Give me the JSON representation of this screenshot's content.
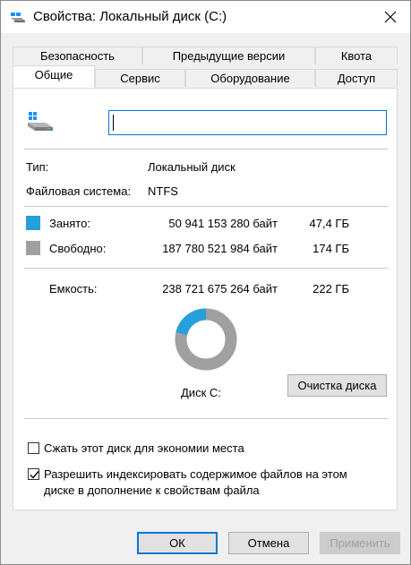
{
  "window": {
    "title": "Свойства: Локальный диск (C:)"
  },
  "tabs": {
    "row1": [
      "Безопасность",
      "Предыдущие версии",
      "Квота"
    ],
    "row2": [
      "Общие",
      "Сервис",
      "Оборудование",
      "Доступ"
    ]
  },
  "general": {
    "name_value": "",
    "type_label": "Тип:",
    "type_value": "Локальный диск",
    "fs_label": "Файловая система:",
    "fs_value": "NTFS",
    "used_label": "Занято:",
    "used_bytes": "50 941 153 280 байт",
    "used_gb": "47,4 ГБ",
    "free_label": "Свободно:",
    "free_bytes": "187 780 521 984 байт",
    "free_gb": "174 ГБ",
    "capacity_label": "Емкость:",
    "capacity_bytes": "238 721 675 264 байт",
    "capacity_gb": "222 ГБ",
    "disk_label": "Диск C:",
    "cleanup_button": "Очистка диска",
    "used_fraction": 0.2134,
    "used_color": "#26a0da",
    "free_color": "#a0a0a0"
  },
  "options": {
    "compress_label": "Сжать этот диск для экономии места",
    "compress_checked": false,
    "index_label_line1": "Разрешить индексировать содержимое файлов на этом",
    "index_label_line2": "диске в дополнение к свойствам файла",
    "index_checked": true
  },
  "buttons": {
    "ok": "ОК",
    "cancel": "Отмена",
    "apply": "Применить"
  }
}
